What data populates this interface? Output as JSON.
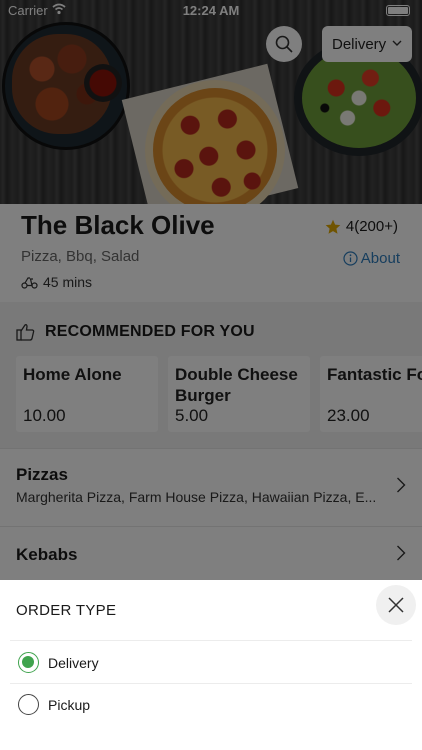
{
  "status_bar": {
    "carrier": "Carrier",
    "time": "12:24 AM"
  },
  "header": {
    "search_icon": "search-icon",
    "order_type_dropdown": "Delivery"
  },
  "restaurant": {
    "name": "The Black Olive",
    "rating": "4(200+)",
    "cuisine": "Pizza, Bbq, Salad",
    "about_label": "About",
    "delivery_time": "45 mins",
    "star_color": "#e0a800",
    "link_color": "#2e7dbd"
  },
  "recommended": {
    "title": "RECOMMENDED FOR YOU",
    "items": [
      {
        "name": "Home Alone",
        "price": "10.00"
      },
      {
        "name": "Double Cheese Burger",
        "price": "5.00"
      },
      {
        "name": "Fantastic Fo",
        "price": "23.00"
      }
    ]
  },
  "categories": [
    {
      "name": "Pizzas",
      "description": "Margherita Pizza, Farm House Pizza, Hawaiian Pizza, E..."
    },
    {
      "name": "Kebabs",
      "description": ""
    }
  ],
  "order_type_sheet": {
    "title": "ORDER TYPE",
    "options": [
      {
        "label": "Delivery",
        "selected": true
      },
      {
        "label": "Pickup",
        "selected": false
      }
    ],
    "accent_color": "#3fa34d"
  }
}
